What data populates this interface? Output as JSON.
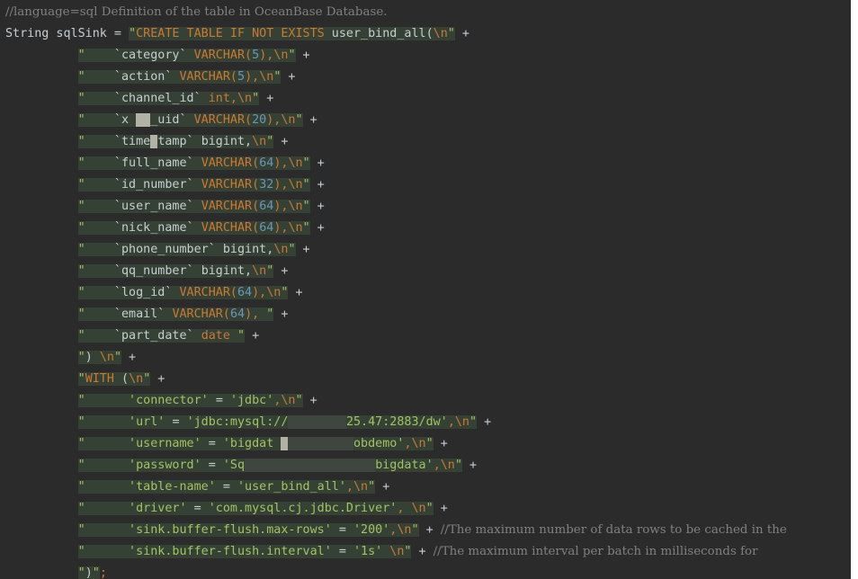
{
  "editor": {
    "lines": [
      {
        "segments": [
          {
            "t": "//language=sql ",
            "c": "comment"
          },
          {
            "t": "Definition of the table in OceanBase Database.",
            "c": "comment"
          }
        ]
      },
      {
        "segments": [
          {
            "t": "String sqlSink = ",
            "c": "plain"
          },
          {
            "t": "\"",
            "c": "str inj"
          },
          {
            "t": "CREATE TABLE IF NOT EXISTS ",
            "c": "kw inj"
          },
          {
            "t": "user_bind_all(",
            "c": "plain inj"
          },
          {
            "t": "\\n",
            "c": "kw inj"
          },
          {
            "t": "\"",
            "c": "str inj"
          },
          {
            "t": " +",
            "c": "plain"
          }
        ]
      },
      {
        "segments": [
          {
            "t": "          ",
            "c": "plain"
          },
          {
            "t": "\"",
            "c": "str inj"
          },
          {
            "t": "    `category` ",
            "c": "plain inj"
          },
          {
            "t": "VARCHAR(",
            "c": "kw inj"
          },
          {
            "t": "5",
            "c": "num inj"
          },
          {
            "t": "),",
            "c": "kw inj"
          },
          {
            "t": "\\n",
            "c": "kw inj"
          },
          {
            "t": "\"",
            "c": "str inj"
          },
          {
            "t": " +",
            "c": "plain"
          }
        ]
      },
      {
        "segments": [
          {
            "t": "          ",
            "c": "plain"
          },
          {
            "t": "\"",
            "c": "str inj"
          },
          {
            "t": "    `action` ",
            "c": "plain inj"
          },
          {
            "t": "VARCHAR(",
            "c": "kw inj"
          },
          {
            "t": "5",
            "c": "num inj"
          },
          {
            "t": "),",
            "c": "kw inj"
          },
          {
            "t": "\\n",
            "c": "kw inj"
          },
          {
            "t": "\"",
            "c": "str inj"
          },
          {
            "t": " +",
            "c": "plain"
          }
        ]
      },
      {
        "segments": [
          {
            "t": "          ",
            "c": "plain"
          },
          {
            "t": "\"",
            "c": "str inj"
          },
          {
            "t": "    `channel_id` ",
            "c": "plain inj"
          },
          {
            "t": "int,",
            "c": "kw inj"
          },
          {
            "t": "\\n",
            "c": "kw inj"
          },
          {
            "t": "\"",
            "c": "str inj"
          },
          {
            "t": " +",
            "c": "plain"
          }
        ]
      },
      {
        "segments": [
          {
            "t": "          ",
            "c": "plain"
          },
          {
            "t": "\"",
            "c": "str inj"
          },
          {
            "t": "    `x ",
            "c": "plain inj"
          },
          {
            "t": "  ",
            "c": "blur"
          },
          {
            "t": "_uid` ",
            "c": "plain inj"
          },
          {
            "t": "VARCHAR(",
            "c": "kw inj"
          },
          {
            "t": "20",
            "c": "num inj"
          },
          {
            "t": "),",
            "c": "kw inj"
          },
          {
            "t": "\\n",
            "c": "kw inj"
          },
          {
            "t": "\"",
            "c": "str inj"
          },
          {
            "t": " +",
            "c": "plain"
          }
        ]
      },
      {
        "segments": [
          {
            "t": "          ",
            "c": "plain"
          },
          {
            "t": "\"",
            "c": "str inj"
          },
          {
            "t": "    `time",
            "c": "plain inj"
          },
          {
            "t": " ",
            "c": "blur"
          },
          {
            "t": "tamp` ",
            "c": "plain inj"
          },
          {
            "t": "bigint,",
            "c": "plain inj"
          },
          {
            "t": "\\n",
            "c": "kw inj"
          },
          {
            "t": "\"",
            "c": "str inj"
          },
          {
            "t": " +",
            "c": "plain"
          }
        ]
      },
      {
        "segments": [
          {
            "t": "          ",
            "c": "plain"
          },
          {
            "t": "\"",
            "c": "str inj"
          },
          {
            "t": "    `full_name` ",
            "c": "plain inj"
          },
          {
            "t": "VARCHAR(",
            "c": "kw inj"
          },
          {
            "t": "64",
            "c": "num inj"
          },
          {
            "t": "),",
            "c": "kw inj"
          },
          {
            "t": "\\n",
            "c": "kw inj"
          },
          {
            "t": "\"",
            "c": "str inj"
          },
          {
            "t": " +",
            "c": "plain"
          }
        ]
      },
      {
        "segments": [
          {
            "t": "          ",
            "c": "plain"
          },
          {
            "t": "\"",
            "c": "str inj"
          },
          {
            "t": "    `id_number` ",
            "c": "plain inj"
          },
          {
            "t": "VARCHAR(",
            "c": "kw inj"
          },
          {
            "t": "32",
            "c": "num inj"
          },
          {
            "t": "),",
            "c": "kw inj"
          },
          {
            "t": "\\n",
            "c": "kw inj"
          },
          {
            "t": "\"",
            "c": "str inj"
          },
          {
            "t": " +",
            "c": "plain"
          }
        ]
      },
      {
        "segments": [
          {
            "t": "          ",
            "c": "plain"
          },
          {
            "t": "\"",
            "c": "str inj"
          },
          {
            "t": "    `user_name` ",
            "c": "plain inj"
          },
          {
            "t": "VARCHAR(",
            "c": "kw inj"
          },
          {
            "t": "64",
            "c": "num inj"
          },
          {
            "t": "),",
            "c": "kw inj"
          },
          {
            "t": "\\n",
            "c": "kw inj"
          },
          {
            "t": "\"",
            "c": "str inj"
          },
          {
            "t": " +",
            "c": "plain"
          }
        ]
      },
      {
        "segments": [
          {
            "t": "          ",
            "c": "plain"
          },
          {
            "t": "\"",
            "c": "str inj"
          },
          {
            "t": "    `nick_name` ",
            "c": "plain inj"
          },
          {
            "t": "VARCHAR(",
            "c": "kw inj"
          },
          {
            "t": "64",
            "c": "num inj"
          },
          {
            "t": "),",
            "c": "kw inj"
          },
          {
            "t": "\\n",
            "c": "kw inj"
          },
          {
            "t": "\"",
            "c": "str inj"
          },
          {
            "t": " +",
            "c": "plain"
          }
        ]
      },
      {
        "segments": [
          {
            "t": "          ",
            "c": "plain"
          },
          {
            "t": "\"",
            "c": "str inj"
          },
          {
            "t": "    `phone_number` ",
            "c": "plain inj"
          },
          {
            "t": "bigint,",
            "c": "plain inj"
          },
          {
            "t": "\\n",
            "c": "kw inj"
          },
          {
            "t": "\"",
            "c": "str inj"
          },
          {
            "t": " +",
            "c": "plain"
          }
        ]
      },
      {
        "segments": [
          {
            "t": "          ",
            "c": "plain"
          },
          {
            "t": "\"",
            "c": "str inj"
          },
          {
            "t": "    `qq_number` ",
            "c": "plain inj"
          },
          {
            "t": "bigint,",
            "c": "plain inj"
          },
          {
            "t": "\\n",
            "c": "kw inj"
          },
          {
            "t": "\"",
            "c": "str inj"
          },
          {
            "t": " +",
            "c": "plain"
          }
        ]
      },
      {
        "segments": [
          {
            "t": "          ",
            "c": "plain"
          },
          {
            "t": "\"",
            "c": "str inj"
          },
          {
            "t": "    `log_id` ",
            "c": "plain inj"
          },
          {
            "t": "VARCHAR(",
            "c": "kw inj"
          },
          {
            "t": "64",
            "c": "num inj"
          },
          {
            "t": "),",
            "c": "kw inj"
          },
          {
            "t": "\\n",
            "c": "kw inj"
          },
          {
            "t": "\"",
            "c": "str inj"
          },
          {
            "t": " +",
            "c": "plain"
          }
        ]
      },
      {
        "segments": [
          {
            "t": "          ",
            "c": "plain"
          },
          {
            "t": "\"",
            "c": "str inj"
          },
          {
            "t": "    `email` ",
            "c": "plain inj"
          },
          {
            "t": "VARCHAR(",
            "c": "kw inj"
          },
          {
            "t": "64",
            "c": "num inj"
          },
          {
            "t": "), ",
            "c": "kw inj"
          },
          {
            "t": "\"",
            "c": "str inj"
          },
          {
            "t": " +",
            "c": "plain"
          }
        ]
      },
      {
        "segments": [
          {
            "t": "          ",
            "c": "plain"
          },
          {
            "t": "\"",
            "c": "str inj"
          },
          {
            "t": "    `part_date` ",
            "c": "plain inj"
          },
          {
            "t": "date ",
            "c": "kw inj"
          },
          {
            "t": "\"",
            "c": "str inj"
          },
          {
            "t": " +",
            "c": "plain"
          }
        ]
      },
      {
        "segments": [
          {
            "t": "          ",
            "c": "plain"
          },
          {
            "t": "\"",
            "c": "str inj"
          },
          {
            "t": ") ",
            "c": "plain inj"
          },
          {
            "t": "\\n",
            "c": "kw inj"
          },
          {
            "t": "\"",
            "c": "str inj"
          },
          {
            "t": " +",
            "c": "plain"
          }
        ]
      },
      {
        "segments": [
          {
            "t": "          ",
            "c": "plain"
          },
          {
            "t": "\"",
            "c": "str inj"
          },
          {
            "t": "WITH ",
            "c": "kw inj"
          },
          {
            "t": "(",
            "c": "plain inj"
          },
          {
            "t": "\\n",
            "c": "kw inj"
          },
          {
            "t": "\"",
            "c": "str inj"
          },
          {
            "t": " +",
            "c": "plain"
          }
        ]
      },
      {
        "segments": [
          {
            "t": "          ",
            "c": "plain"
          },
          {
            "t": "\"",
            "c": "str inj"
          },
          {
            "t": "      'connector' ",
            "c": "str inj"
          },
          {
            "t": "= ",
            "c": "plain inj"
          },
          {
            "t": "'jdbc'",
            "c": "str inj"
          },
          {
            "t": ",",
            "c": "kw inj"
          },
          {
            "t": "\\n",
            "c": "kw inj"
          },
          {
            "t": "\"",
            "c": "str inj"
          },
          {
            "t": " +",
            "c": "plain"
          }
        ]
      },
      {
        "segments": [
          {
            "t": "          ",
            "c": "plain"
          },
          {
            "t": "\"",
            "c": "str inj"
          },
          {
            "t": "      'url' ",
            "c": "str inj"
          },
          {
            "t": "= ",
            "c": "plain inj"
          },
          {
            "t": "'jdbc:mysql://",
            "c": "str inj"
          },
          {
            "t": "        ",
            "c": "blur-soft"
          },
          {
            "t": "25.47:2883/dw'",
            "c": "str inj"
          },
          {
            "t": ",",
            "c": "kw inj"
          },
          {
            "t": "\\n",
            "c": "kw inj"
          },
          {
            "t": "\"",
            "c": "str inj"
          },
          {
            "t": " +",
            "c": "plain"
          }
        ]
      },
      {
        "segments": [
          {
            "t": "          ",
            "c": "plain"
          },
          {
            "t": "\"",
            "c": "str inj"
          },
          {
            "t": "      'username' ",
            "c": "str inj"
          },
          {
            "t": "= ",
            "c": "plain inj"
          },
          {
            "t": "'bigdat ",
            "c": "str inj"
          },
          {
            "t": " ",
            "c": "blur"
          },
          {
            "t": "         ",
            "c": "blur-soft"
          },
          {
            "t": "obdemo'",
            "c": "str inj"
          },
          {
            "t": ",",
            "c": "kw inj"
          },
          {
            "t": "\\n",
            "c": "kw inj"
          },
          {
            "t": "\"",
            "c": "str inj"
          },
          {
            "t": " +",
            "c": "plain"
          }
        ]
      },
      {
        "segments": [
          {
            "t": "          ",
            "c": "plain"
          },
          {
            "t": "\"",
            "c": "str inj"
          },
          {
            "t": "      'password' ",
            "c": "str inj"
          },
          {
            "t": "= ",
            "c": "plain inj"
          },
          {
            "t": "'Sq",
            "c": "str inj"
          },
          {
            "t": "                  ",
            "c": "blur-soft"
          },
          {
            "t": "bigdata'",
            "c": "str inj"
          },
          {
            "t": ",",
            "c": "kw inj"
          },
          {
            "t": "\\n",
            "c": "kw inj"
          },
          {
            "t": "\"",
            "c": "str inj"
          },
          {
            "t": " +",
            "c": "plain"
          }
        ]
      },
      {
        "segments": [
          {
            "t": "          ",
            "c": "plain"
          },
          {
            "t": "\"",
            "c": "str inj"
          },
          {
            "t": "      'table-name' ",
            "c": "str inj"
          },
          {
            "t": "= ",
            "c": "plain inj"
          },
          {
            "t": "'user_bind_all'",
            "c": "str inj"
          },
          {
            "t": ",",
            "c": "kw inj"
          },
          {
            "t": "\\n",
            "c": "kw inj"
          },
          {
            "t": "\"",
            "c": "str inj"
          },
          {
            "t": " +",
            "c": "plain"
          }
        ]
      },
      {
        "segments": [
          {
            "t": "          ",
            "c": "plain"
          },
          {
            "t": "\"",
            "c": "str inj"
          },
          {
            "t": "      'driver' ",
            "c": "str inj"
          },
          {
            "t": "= ",
            "c": "plain inj"
          },
          {
            "t": "'com.mysql.cj.jdbc.Driver'",
            "c": "str inj"
          },
          {
            "t": ", ",
            "c": "kw inj"
          },
          {
            "t": "\\n",
            "c": "kw inj"
          },
          {
            "t": "\"",
            "c": "str inj"
          },
          {
            "t": " +",
            "c": "plain"
          }
        ]
      },
      {
        "segments": [
          {
            "t": "          ",
            "c": "plain"
          },
          {
            "t": "\"",
            "c": "str inj"
          },
          {
            "t": "      'sink.buffer-flush.max-rows' ",
            "c": "str inj"
          },
          {
            "t": "= ",
            "c": "plain inj"
          },
          {
            "t": "'200'",
            "c": "str inj"
          },
          {
            "t": ",",
            "c": "kw inj"
          },
          {
            "t": "\\n",
            "c": "kw inj"
          },
          {
            "t": "\"",
            "c": "str inj"
          },
          {
            "t": " + ",
            "c": "plain"
          },
          {
            "t": "//The maximum number of data rows to be cached in the",
            "c": "comment"
          }
        ]
      },
      {
        "segments": [
          {
            "t": "          ",
            "c": "plain"
          },
          {
            "t": "\"",
            "c": "str inj"
          },
          {
            "t": "      'sink.buffer-flush.interval' ",
            "c": "str inj"
          },
          {
            "t": "= ",
            "c": "plain inj"
          },
          {
            "t": "'1s' ",
            "c": "str inj"
          },
          {
            "t": "\\n",
            "c": "kw inj"
          },
          {
            "t": "\"",
            "c": "str inj"
          },
          {
            "t": " + ",
            "c": "plain"
          },
          {
            "t": "//The maximum interval per batch in milliseconds for",
            "c": "comment"
          }
        ]
      },
      {
        "segments": [
          {
            "t": "          ",
            "c": "plain"
          },
          {
            "t": "\"",
            "c": "str inj"
          },
          {
            "t": ")",
            "c": "plain inj"
          },
          {
            "t": "\"",
            "c": "str inj"
          },
          {
            "t": ";",
            "c": "kw"
          }
        ]
      }
    ]
  }
}
